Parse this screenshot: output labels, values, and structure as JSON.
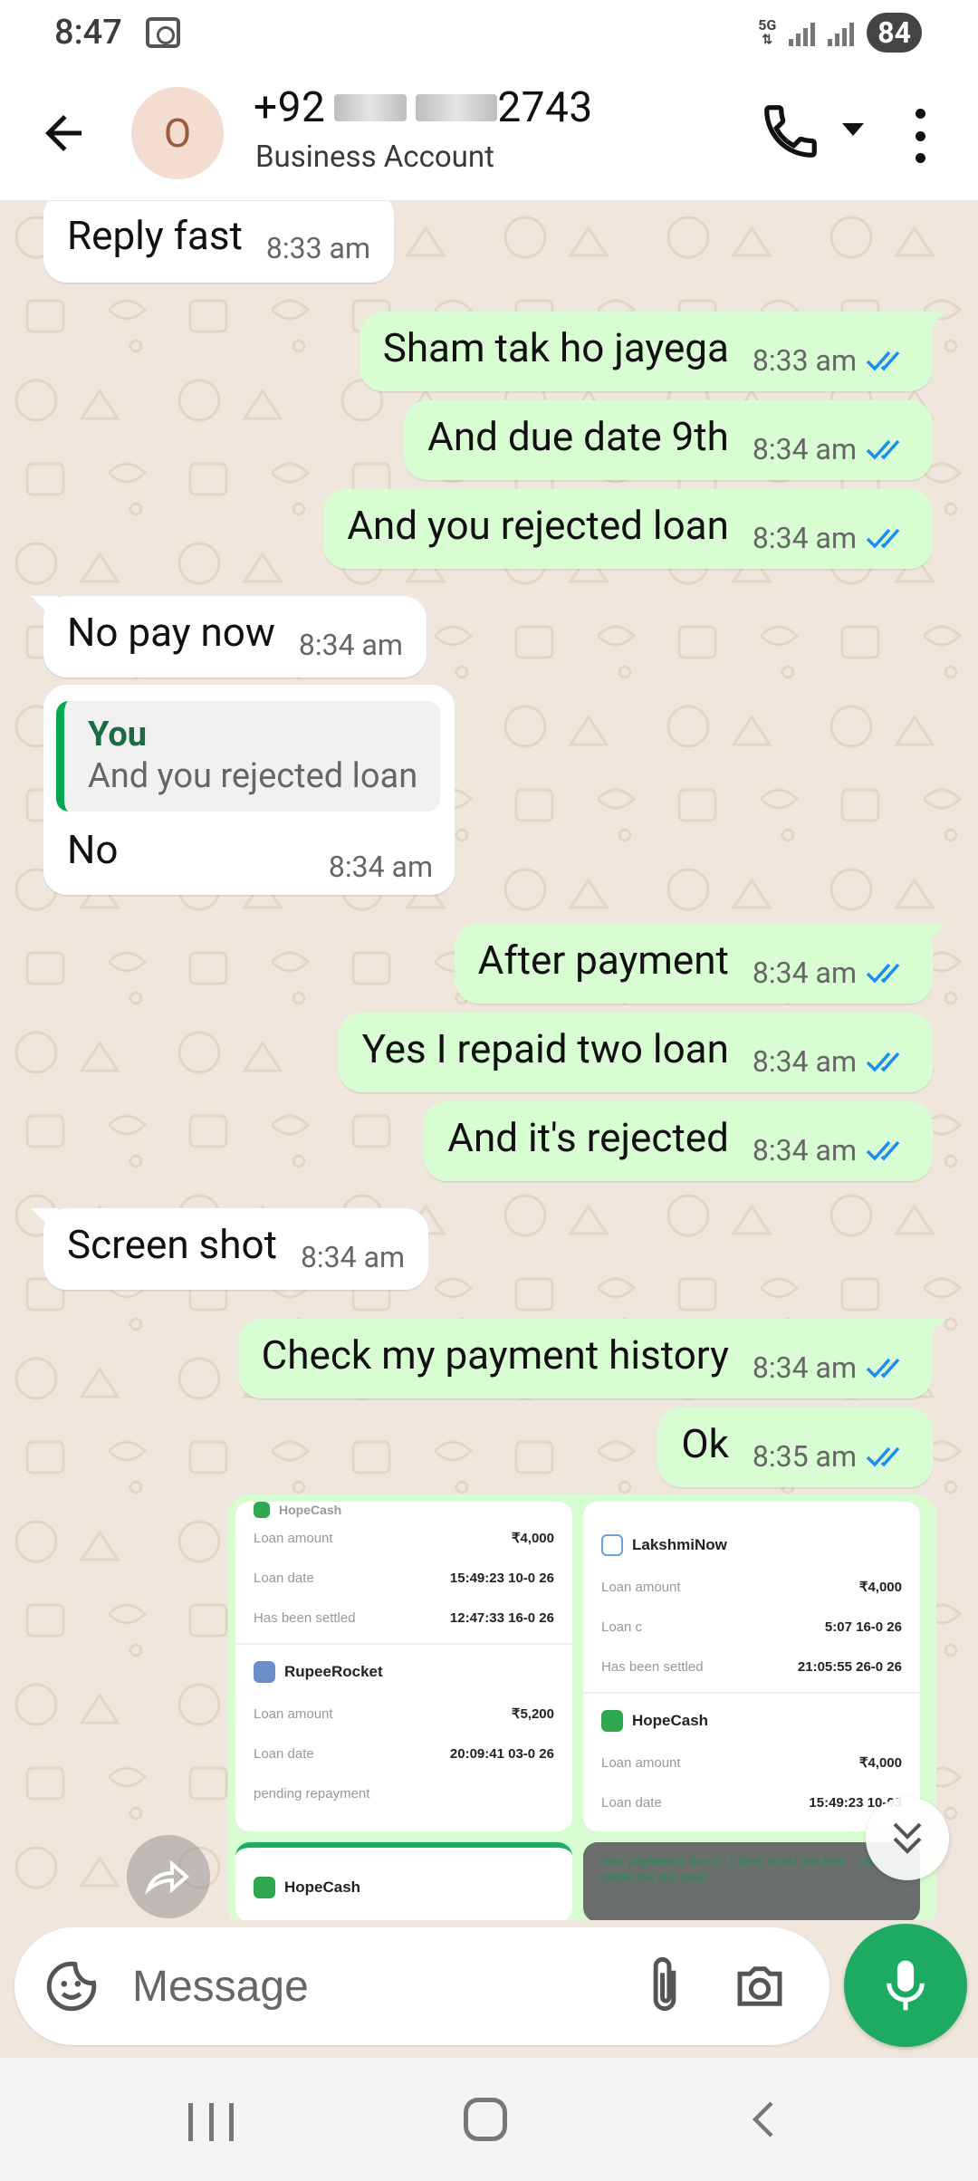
{
  "status_bar": {
    "time": "8:47",
    "network": "5G",
    "battery": "84"
  },
  "header": {
    "avatar_letter": "O",
    "contact_prefix": "+92",
    "contact_suffix": "2743",
    "subtitle": "Business Account"
  },
  "messages": [
    {
      "dir": "in",
      "text": "Reply fast",
      "time": "8:33 am"
    },
    {
      "dir": "out",
      "text": "Sham tak ho jayega",
      "time": "8:33 am"
    },
    {
      "dir": "out",
      "text": "And due date 9th",
      "time": "8:34 am"
    },
    {
      "dir": "out",
      "text": "And you rejected loan",
      "time": "8:34 am"
    },
    {
      "dir": "in",
      "text": "No pay now",
      "time": "8:34 am"
    },
    {
      "dir": "in",
      "text": "No",
      "time": "8:34 am",
      "quote_author": "You",
      "quote_text": "And you rejected loan"
    },
    {
      "dir": "out",
      "text": "After payment",
      "time": "8:34 am"
    },
    {
      "dir": "out",
      "text": "Yes I repaid two loan",
      "time": "8:34 am"
    },
    {
      "dir": "out",
      "text": "And it's rejected",
      "time": "8:34 am"
    },
    {
      "dir": "in",
      "text": "Screen shot",
      "time": "8:34 am"
    },
    {
      "dir": "out",
      "text": "Check my payment history",
      "time": "8:34 am"
    },
    {
      "dir": "out",
      "text": "Ok",
      "time": "8:35 am"
    }
  ],
  "media": {
    "shot1": {
      "brand_top": "HopeCash",
      "rows": [
        {
          "label": "Loan amount",
          "value": "₹4,000"
        },
        {
          "label": "Loan date",
          "value": "15:49:23 10-0  26"
        },
        {
          "label": "Has been settled",
          "value": "12:47:33 16-0  26"
        }
      ],
      "brand2": "RupeeRocket",
      "rows2": [
        {
          "label": "Loan amount",
          "value": "₹5,200"
        },
        {
          "label": "Loan date",
          "value": "20:09:41 03-0  26"
        }
      ],
      "status2": "pending repayment"
    },
    "shot2": {
      "brand": "LakshmiNow",
      "rows": [
        {
          "label": "Loan amount",
          "value": "₹4,000"
        },
        {
          "label": "Loan c",
          "value": "5:07 16-0  26"
        },
        {
          "label": "Has been settled",
          "value": "21:05:55 26-0  26"
        }
      ],
      "brand2": "HopeCash",
      "rows2": [
        {
          "label": "Loan amount",
          "value": "₹4,000"
        },
        {
          "label": "Loan date",
          "value": "15:49:23 10-03"
        }
      ]
    },
    "shot3": {
      "brand": "HopeCash"
    },
    "shot4": {
      "banner": "Your payment is due in -1 days. Avoid late fees – repay before the due date!"
    }
  },
  "input": {
    "placeholder": "Message"
  },
  "colors": {
    "outgoing_bubble": "#d9fdd3",
    "incoming_bubble": "#ffffff",
    "accent": "#1daa61",
    "tick_blue": "#1b8cf0"
  }
}
